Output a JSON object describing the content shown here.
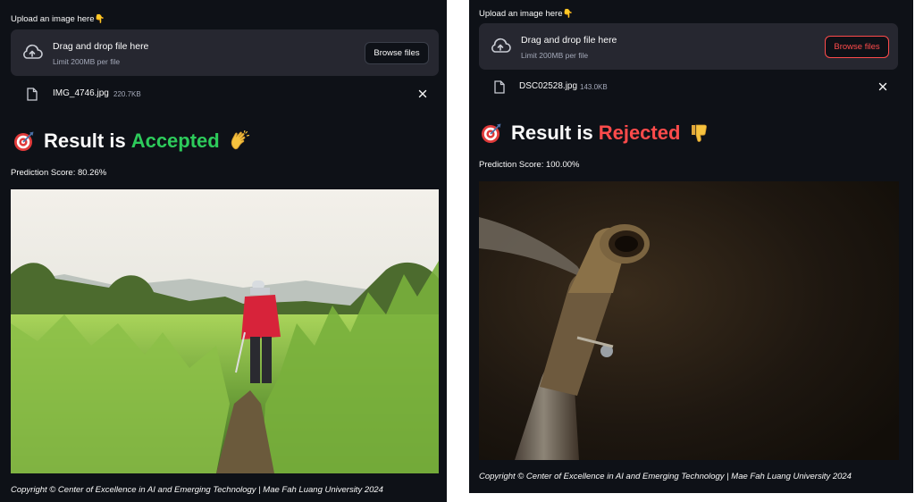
{
  "panels": [
    {
      "upload_label": "Upload an image here👇",
      "dropzone": {
        "title": "Drag and drop file here",
        "subtitle": "Limit 200MB per file",
        "browse_label": "Browse files"
      },
      "file": {
        "name": "IMG_4746.jpg",
        "size": "220.7KB"
      },
      "result": {
        "prefix": "Result is",
        "status": "Accepted",
        "status_color": "#2dcb5b"
      },
      "score": "Prediction Score: 80.26%",
      "photo": {
        "alt": "Farmer in red jacket spraying in rice field"
      },
      "copyright": "Copyright © Center of Excellence in AI and Emerging Technology | Mae Fah Luang University 2024"
    },
    {
      "upload_label": "Upload an image here👇",
      "dropzone": {
        "title": "Drag and drop file here",
        "subtitle": "Limit 200MB per file",
        "browse_label": "Browse files"
      },
      "file": {
        "name": "DSC02528.jpg",
        "size": "143.0KB"
      },
      "result": {
        "prefix": "Result is",
        "status": "Rejected",
        "status_color": "#ff4b4b"
      },
      "score": "Prediction Score: 100.00%",
      "photo": {
        "alt": "Close-up of rusty metal sprayer nozzle"
      },
      "copyright": "Copyright © Center of Excellence in AI and Emerging Technology | Mae Fah Luang University 2024"
    }
  ],
  "icons": {
    "upload": "cloud-upload-icon",
    "file": "file-icon",
    "remove": "close-icon",
    "target": "direct-hit-emoji",
    "accepted_hand": "clapping-hands-emoji",
    "rejected_hand": "thumbs-down-emoji"
  },
  "colors": {
    "background": "#0e1117",
    "dropzone": "#262730",
    "accepted": "#2dcb5b",
    "rejected": "#ff4b4b"
  }
}
